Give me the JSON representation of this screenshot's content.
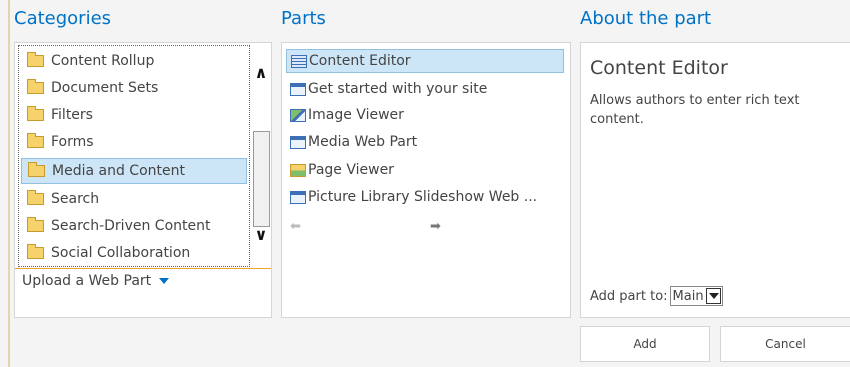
{
  "categories": {
    "title": "Categories",
    "items": [
      {
        "label": "Content Rollup",
        "selected": false
      },
      {
        "label": "Document Sets",
        "selected": false
      },
      {
        "label": "Filters",
        "selected": false
      },
      {
        "label": "Forms",
        "selected": false
      },
      {
        "label": "Media and Content",
        "selected": true
      },
      {
        "label": "Search",
        "selected": false
      },
      {
        "label": "Search-Driven Content",
        "selected": false
      },
      {
        "label": "Social Collaboration",
        "selected": false
      }
    ],
    "upload_label": "Upload a Web Part"
  },
  "parts": {
    "title": "Parts",
    "items": [
      {
        "label": "Content Editor",
        "icon": "content-editor-icon",
        "selected": true
      },
      {
        "label": "Get started with your site",
        "icon": "web-part-icon",
        "selected": false
      },
      {
        "label": "Image Viewer",
        "icon": "image-viewer-icon",
        "selected": false
      },
      {
        "label": "Media Web Part",
        "icon": "web-part-icon",
        "selected": false
      },
      {
        "label": "Page Viewer",
        "icon": "page-viewer-icon",
        "selected": false
      },
      {
        "label": "Picture Library Slideshow Web ...",
        "icon": "web-part-icon",
        "selected": false
      }
    ]
  },
  "about": {
    "title": "About the part",
    "part_name": "Content Editor",
    "description": "Allows authors to enter rich text content.",
    "add_to_label": "Add part to:",
    "zone_value": "Main"
  },
  "actions": {
    "add_label": "Add",
    "cancel_label": "Cancel"
  },
  "colors": {
    "heading": "#0072c6",
    "selection": "#cde6f7",
    "accent_line": "#f0a32b"
  }
}
